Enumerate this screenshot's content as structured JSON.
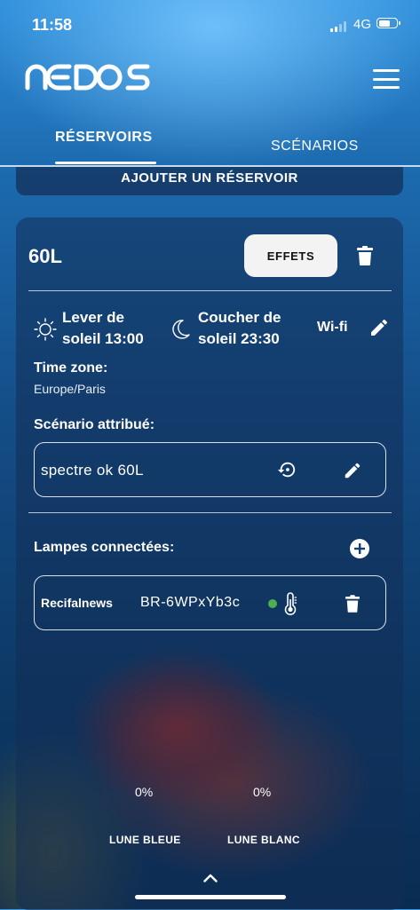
{
  "status_bar": {
    "time": "11:58",
    "network": "4G"
  },
  "header": {
    "logo": "NEDOS"
  },
  "tabs": [
    {
      "label": "RÉSERVOIRS",
      "active": true
    },
    {
      "label": "SCÉNARIOS",
      "active": false
    }
  ],
  "add_tank_label": "AJOUTER UN RÉSERVOIR",
  "tank": {
    "name": "60L",
    "effects_label": "EFFETS",
    "sunrise_line1": "Lever de",
    "sunrise_line2": "soleil 13:00",
    "sunset_line1": "Coucher de",
    "sunset_line2": "soleil 23:30",
    "wifi_label": "Wi-fi",
    "timezone_label": "Time zone:",
    "timezone_value": "Europe/Paris",
    "scenario_label": "Scénario attribué:",
    "scenario_value": "spectre ok 60L",
    "lamps_label": "Lampes connectées:",
    "lamp": {
      "brand": "Recifalnews",
      "id": "BR-6WPxYb3c",
      "status_color": "#4caf50"
    }
  },
  "moonlights": [
    {
      "value": "0%",
      "label": "LUNE BLEUE"
    },
    {
      "value": "0%",
      "label": "LUNE BLANC"
    }
  ],
  "colors": {
    "effects_button_bg": "#f3f3f3",
    "online_dot": "#4caf50"
  }
}
